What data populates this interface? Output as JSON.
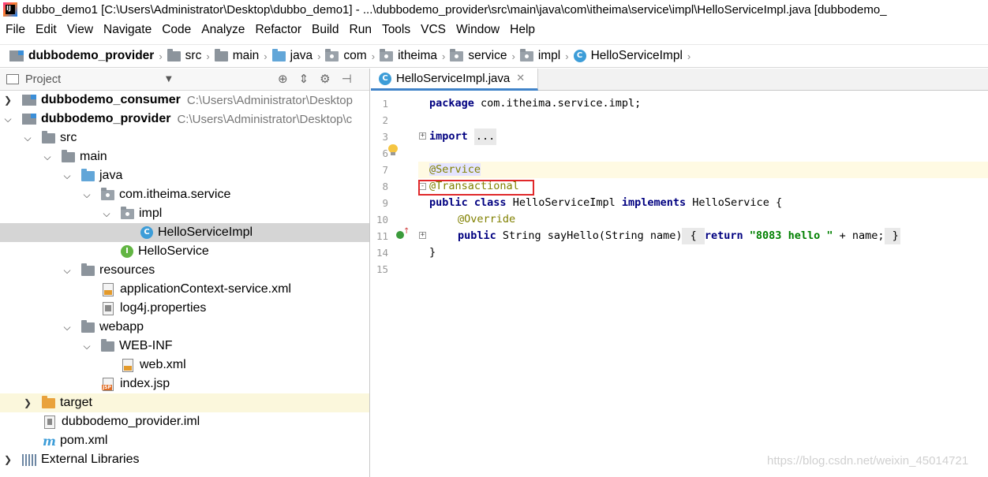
{
  "window": {
    "title": "dubbo_demo1 [C:\\Users\\Administrator\\Desktop\\dubbo_demo1] - ...\\dubbodemo_provider\\src\\main\\java\\com\\itheima\\service\\impl\\HelloServiceImpl.java [dubbodemo_"
  },
  "menu": [
    "File",
    "Edit",
    "View",
    "Navigate",
    "Code",
    "Analyze",
    "Refactor",
    "Build",
    "Run",
    "Tools",
    "VCS",
    "Window",
    "Help"
  ],
  "breadcrumb": {
    "module": "dubbodemo_provider",
    "src": "src",
    "main": "main",
    "java": "java",
    "com": "com",
    "itheima": "itheima",
    "service": "service",
    "impl": "impl",
    "class": "HelloServiceImpl"
  },
  "project_panel": {
    "title": "Project",
    "tree": {
      "consumer": {
        "name": "dubbodemo_consumer",
        "path": "C:\\Users\\Administrator\\Desktop"
      },
      "provider": {
        "name": "dubbodemo_provider",
        "path": "C:\\Users\\Administrator\\Desktop\\c"
      },
      "src": "src",
      "main": "main",
      "java": "java",
      "pkg": "com.itheima.service",
      "impl": "impl",
      "impl_class": "HelloServiceImpl",
      "iface": "HelloService",
      "resources": "resources",
      "app_ctx": "applicationContext-service.xml",
      "log4j": "log4j.properties",
      "webapp": "webapp",
      "webinf": "WEB-INF",
      "webxml": "web.xml",
      "indexjsp": "index.jsp",
      "target": "target",
      "iml": "dubbodemo_provider.iml",
      "pom": "pom.xml",
      "libs": "External Libraries"
    }
  },
  "editor": {
    "tab": "HelloServiceImpl.java",
    "line_numbers": [
      "1",
      "2",
      "3",
      "6",
      "7",
      "8",
      "9",
      "10",
      "11",
      "14",
      "15"
    ],
    "code": {
      "l1_kw": "package",
      "l1_rest": " com.itheima.service.impl;",
      "l3_kw": "import",
      "l3_fold": "...",
      "l7": "@Service",
      "l8": "@Transactional",
      "l9_kw1": "public",
      "l9_kw2": "class",
      "l9_name": " HelloServiceImpl ",
      "l9_kw3": "implements",
      "l9_rest": " HelloService {",
      "l10": "@Override",
      "l11_kw1": "public",
      "l11_mid": " String sayHello(String name)",
      "l11_open": " { ",
      "l11_kw2": "return",
      "l11_str": "\"8083 hello \"",
      "l11_rest": " + name;",
      "l11_close": " }",
      "l14": "}"
    }
  },
  "watermark": "https://blog.csdn.net/weixin_45014721"
}
